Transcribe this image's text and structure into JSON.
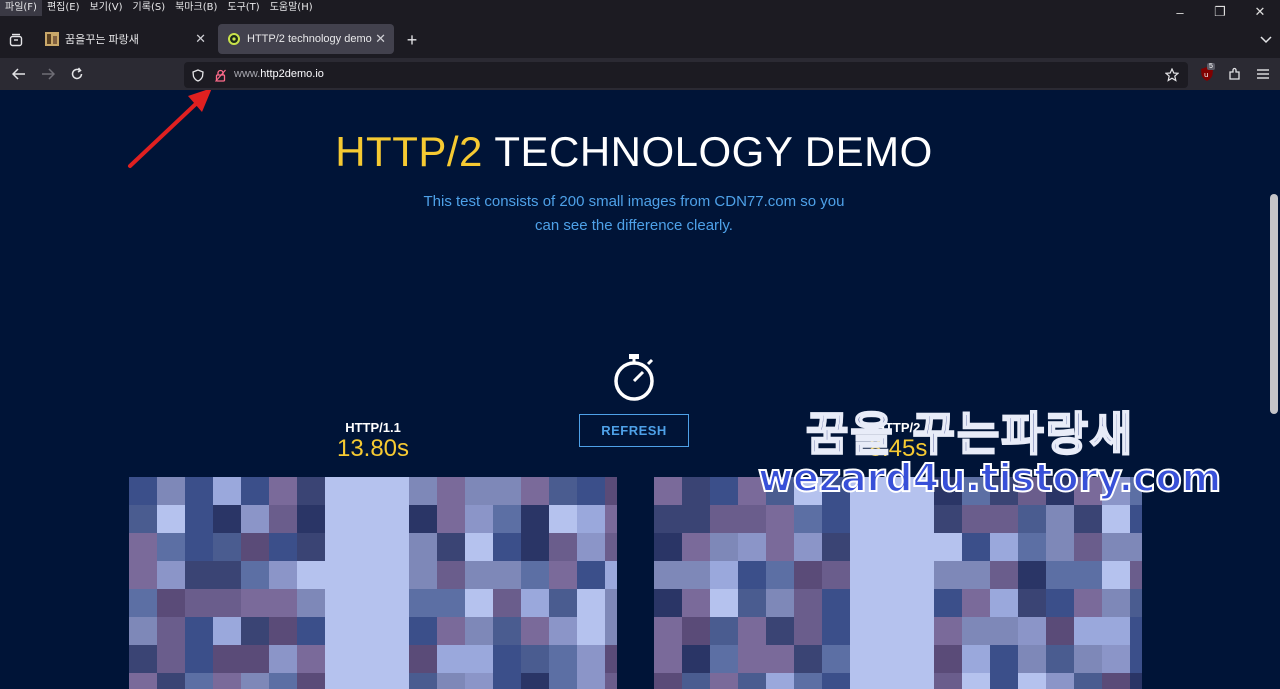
{
  "menu": [
    "파일(F)",
    "편집(E)",
    "보기(V)",
    "기록(S)",
    "북마크(B)",
    "도구(T)",
    "도움말(H)"
  ],
  "tabs": [
    {
      "title": "꿈을꾸는 파랑새"
    },
    {
      "title": "HTTP/2 technology demo"
    }
  ],
  "url": {
    "host_prefix": "www.",
    "host": "http2demo.io"
  },
  "extension_badge": "5",
  "page": {
    "headline_accent": "HTTP/2",
    "headline_rest": " TECHNOLOGY DEMO",
    "subtitle": "This test consists of 200 small images from CDN77.com so you can see the difference clearly.",
    "refresh_label": "REFRESH",
    "left": {
      "protocol": "HTTP/1.1",
      "time": "13.80s"
    },
    "right": {
      "protocol": "HTTP/2",
      "time": "8.45s"
    }
  },
  "watermark": {
    "line1": "꿈을 꾸는파랑새",
    "line2": "wezard4u.tistory.com"
  },
  "colors": {
    "background": "#001437",
    "accent_yellow": "#f6ca32",
    "accent_blue": "#4ea1e8",
    "annotation_arrow": "#e02020"
  }
}
